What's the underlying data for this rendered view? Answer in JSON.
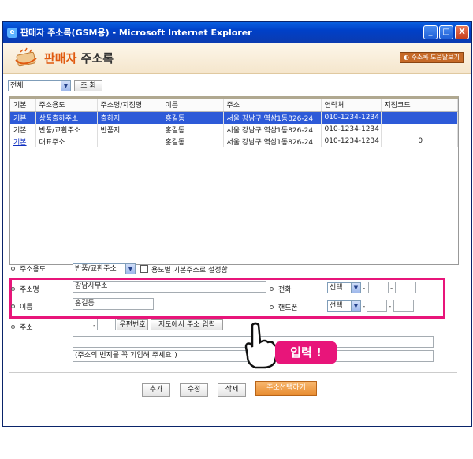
{
  "window": {
    "title": "판매자 주소록(GSM용) - Microsoft Internet Explorer",
    "min_btn": "_",
    "max_btn": "□",
    "close_btn": "X"
  },
  "header": {
    "title_part1": "판매자",
    "title_part2": "주소록",
    "help_button": "주소록 도움말보기"
  },
  "filter": {
    "selected": "전체",
    "search_button": "조 회"
  },
  "grid": {
    "columns": [
      "기본",
      "주소용도",
      "주소명/지점명",
      "이름",
      "주소",
      "연락처",
      "지점코드"
    ],
    "rows": [
      [
        "기본",
        "상품출하주소",
        "출하지",
        "홍길동",
        "서울 강남구 역삼1동826-24",
        "010-1234-1234",
        ""
      ],
      [
        "기본",
        "반품/교환주소",
        "반품지",
        "홍길동",
        "서울 강남구 역삼1동826-24",
        "010-1234-1234",
        ""
      ],
      [
        "기본",
        "대표주소",
        "",
        "홍길동",
        "서울 강남구 역삼1동826-24",
        "010-1234-1234",
        "0"
      ]
    ]
  },
  "form": {
    "usage_label": "주소용도",
    "usage_selected": "반품/교환주소",
    "default_checkbox_label": "용도별 기본주소로 설정함",
    "name_label": "주소명",
    "name_value": "강남사무소",
    "person_label": "이름",
    "person_value": "홍길동",
    "phone_label": "전화",
    "phone_select": "선택",
    "mobile_label": "핸드폰",
    "mobile_select": "선택",
    "dash": "-",
    "address_label": "주소",
    "zip_button": "우편번호",
    "map_button": "지도에서 주소 입력",
    "zip_dash": "-",
    "address_note": "(주소의 번지를 꼭 기입해 주세요!)"
  },
  "actions": {
    "add": "추가",
    "edit": "수정",
    "delete": "삭제",
    "select": "주소선택하기"
  },
  "callout": {
    "text": "입력 !"
  },
  "colors": {
    "highlight": "#e8157a",
    "accent": "#e05a10",
    "selected_row": "#2d5ad8"
  }
}
